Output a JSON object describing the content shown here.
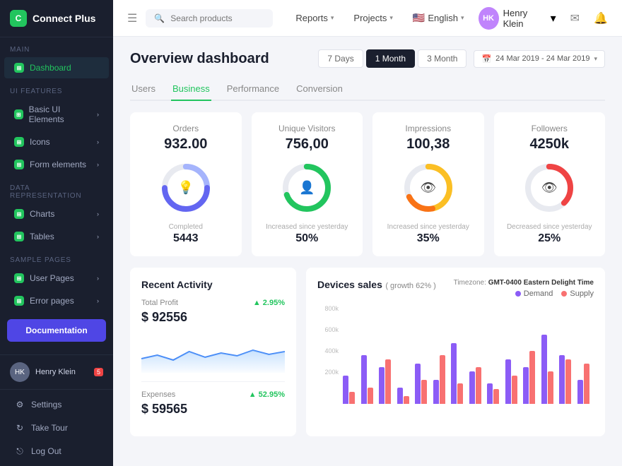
{
  "sidebar": {
    "logo_text": "Connect Plus",
    "logo_icon": "C",
    "sections": {
      "main_label": "Main",
      "ui_label": "UI Features",
      "data_label": "Data Representation",
      "sample_label": "Sample Pages"
    },
    "items": {
      "dashboard": "Dashboard",
      "basic_ui": "Basic UI Elements",
      "icons": "Icons",
      "form_elements": "Form elements",
      "charts": "Charts",
      "tables": "Tables",
      "user_pages": "User Pages",
      "error_pages": "Error pages"
    },
    "doc_button": "Documentation",
    "user_name": "Henry Klein",
    "user_initials": "HK",
    "user_badge": "5",
    "bottom_items": {
      "settings": "Settings",
      "take_tour": "Take Tour",
      "log_out": "Log Out"
    }
  },
  "topnav": {
    "search_placeholder": "Search products",
    "reports": "Reports",
    "projects": "Projects",
    "language": "English",
    "user_name": "Henry Klein",
    "user_initials": "HK"
  },
  "page": {
    "title": "Overview dashboard",
    "filters": {
      "seven_days": "7 Days",
      "one_month": "1 Month",
      "three_month": "3 Month"
    },
    "date_range": "24 Mar 2019 - 24 Mar 2019",
    "tabs": [
      "Users",
      "Business",
      "Performance",
      "Conversion"
    ]
  },
  "stats": [
    {
      "label": "Orders",
      "value": "932.00",
      "sub_label": "Completed",
      "sub_value": "5443",
      "icon": "💡",
      "colors": [
        "#6366f1",
        "#a5b4fc"
      ],
      "pct": 75
    },
    {
      "label": "Unique Visitors",
      "value": "756,00",
      "sub_label": "Increased since yesterday",
      "sub_value": "50%",
      "icon": "👤",
      "colors": [
        "#22c55e",
        "#bbf7d0"
      ],
      "pct": 70
    },
    {
      "label": "Impressions",
      "value": "100,38",
      "sub_label": "Increased since yesterday",
      "sub_value": "35%",
      "icon": "👁",
      "colors": [
        "#f59e0b",
        "#fed7aa"
      ],
      "pct": 55
    },
    {
      "label": "Followers",
      "value": "4250k",
      "sub_label": "Decreased since yesterday",
      "sub_value": "25%",
      "icon": "👁",
      "colors": [
        "#ef4444",
        "#fecaca"
      ],
      "pct": 45
    }
  ],
  "recent_activity": {
    "title": "Recent Activity",
    "profit_label": "Total Profit",
    "profit_change": "▲ 2.95%",
    "profit_value": "$ 92556",
    "expense_label": "Expenses",
    "expense_change": "▲ 52.95%",
    "expense_value": "$ 59565"
  },
  "devices_sales": {
    "title": "Devices sales",
    "subtitle": "( growth 62% )",
    "timezone_label": "Timezone:",
    "timezone_value": "GMT-0400 Eastern Delight Time",
    "legend": {
      "demand": "Demand",
      "supply": "Supply"
    },
    "y_axis": [
      "800k",
      "600k",
      "400k",
      "200k",
      ""
    ],
    "bars": [
      {
        "demand": 35,
        "supply": 15
      },
      {
        "demand": 60,
        "supply": 20
      },
      {
        "demand": 45,
        "supply": 55
      },
      {
        "demand": 20,
        "supply": 10
      },
      {
        "demand": 50,
        "supply": 30
      },
      {
        "demand": 30,
        "supply": 60
      },
      {
        "demand": 75,
        "supply": 25
      },
      {
        "demand": 40,
        "supply": 45
      },
      {
        "demand": 25,
        "supply": 18
      },
      {
        "demand": 55,
        "supply": 35
      },
      {
        "demand": 45,
        "supply": 65
      },
      {
        "demand": 85,
        "supply": 40
      },
      {
        "demand": 60,
        "supply": 55
      },
      {
        "demand": 30,
        "supply": 50
      }
    ]
  }
}
